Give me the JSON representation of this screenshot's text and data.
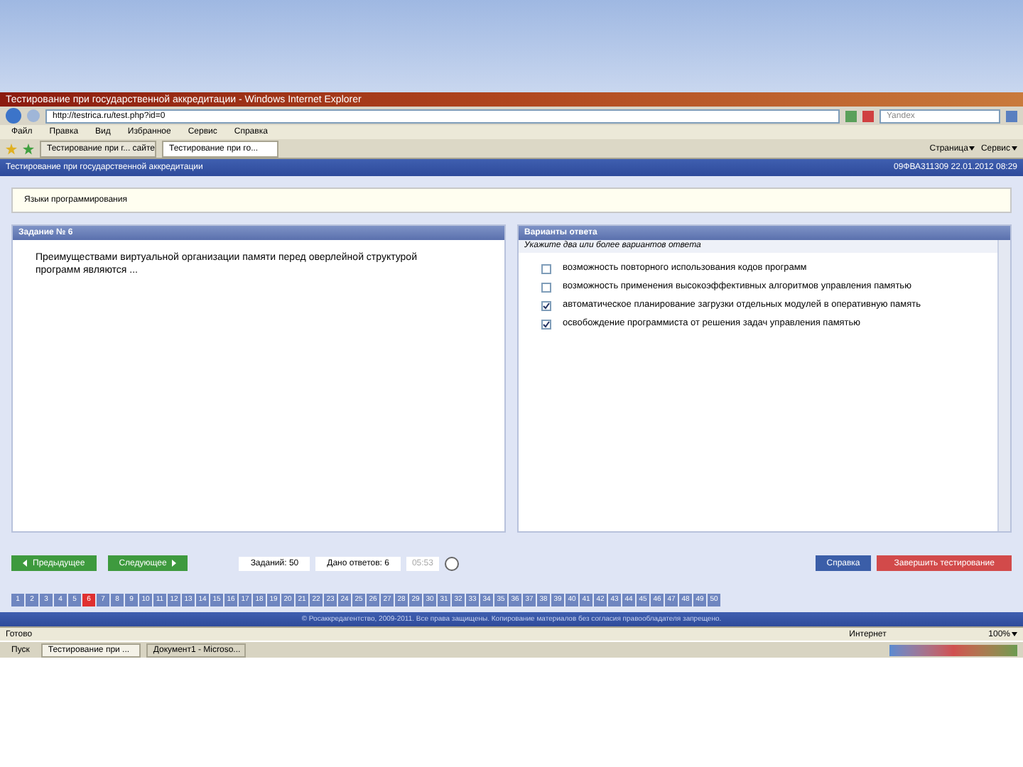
{
  "window": {
    "title": "Тестирование при государственной аккредитации - Windows Internet Explorer"
  },
  "address_bar": {
    "url": "http://testrica.ru/test.php?id=0"
  },
  "search": {
    "placeholder": "Yandex"
  },
  "menu": [
    "Файл",
    "Правка",
    "Вид",
    "Избранное",
    "Сервис",
    "Справка"
  ],
  "tabs": [
    {
      "label": "Тестирование при г... сайте",
      "selected": false
    },
    {
      "label": "Тестирование при го...",
      "selected": true
    }
  ],
  "toolbar_right": [
    "Страница",
    "Сервис"
  ],
  "page_header": {
    "title": "Тестирование при государственной аккредитации",
    "session": "09ФВА311309 22.01.2012 08:29"
  },
  "discipline": "Языки программирования",
  "task": {
    "title": "Задание № 6",
    "question": "Преимуществами виртуальной организации памяти перед оверлейной структурой программ являются ..."
  },
  "answers": {
    "title": "Варианты ответа",
    "hint": "Укажите два или более вариантов ответа",
    "options": [
      {
        "label": "возможность повторного использования кодов программ",
        "checked": false
      },
      {
        "label": "возможность применения высокоэффективных алгоритмов управления памятью",
        "checked": false
      },
      {
        "label": "автоматическое планирование загрузки отдельных модулей в оперативную память",
        "checked": true
      },
      {
        "label": "освобождение программиста от решения задач управления памятью",
        "checked": true
      }
    ]
  },
  "nav": {
    "prev": "Предыдущее",
    "next": "Следующее",
    "tasks": "Заданий: 50",
    "answered": "Дано ответов: 6",
    "timer": "05:53"
  },
  "actions": {
    "help": "Справка",
    "finish": "Завершить тестирование"
  },
  "task_numbers": [
    {
      "label": "1",
      "selected": false
    },
    {
      "label": "2",
      "selected": false
    },
    {
      "label": "3",
      "selected": false
    },
    {
      "label": "4",
      "selected": false
    },
    {
      "label": "5",
      "selected": false
    },
    {
      "label": "6",
      "selected": true
    },
    {
      "label": "7",
      "selected": false
    },
    {
      "label": "8",
      "selected": false
    },
    {
      "label": "9",
      "selected": false
    },
    {
      "label": "10",
      "selected": false
    },
    {
      "label": "11",
      "selected": false
    },
    {
      "label": "12",
      "selected": false
    },
    {
      "label": "13",
      "selected": false
    },
    {
      "label": "14",
      "selected": false
    },
    {
      "label": "15",
      "selected": false
    },
    {
      "label": "16",
      "selected": false
    },
    {
      "label": "17",
      "selected": false
    },
    {
      "label": "18",
      "selected": false
    },
    {
      "label": "19",
      "selected": false
    },
    {
      "label": "20",
      "selected": false
    },
    {
      "label": "21",
      "selected": false
    },
    {
      "label": "22",
      "selected": false
    },
    {
      "label": "23",
      "selected": false
    },
    {
      "label": "24",
      "selected": false
    },
    {
      "label": "25",
      "selected": false
    },
    {
      "label": "26",
      "selected": false
    },
    {
      "label": "27",
      "selected": false
    },
    {
      "label": "28",
      "selected": false
    },
    {
      "label": "29",
      "selected": false
    },
    {
      "label": "30",
      "selected": false
    },
    {
      "label": "31",
      "selected": false
    },
    {
      "label": "32",
      "selected": false
    },
    {
      "label": "33",
      "selected": false
    },
    {
      "label": "34",
      "selected": false
    },
    {
      "label": "35",
      "selected": false
    },
    {
      "label": "36",
      "selected": false
    },
    {
      "label": "37",
      "selected": false
    },
    {
      "label": "38",
      "selected": false
    },
    {
      "label": "39",
      "selected": false
    },
    {
      "label": "40",
      "selected": false
    },
    {
      "label": "41",
      "selected": false
    },
    {
      "label": "42",
      "selected": false
    },
    {
      "label": "43",
      "selected": false
    },
    {
      "label": "44",
      "selected": false
    },
    {
      "label": "45",
      "selected": false
    },
    {
      "label": "46",
      "selected": false
    },
    {
      "label": "47",
      "selected": false
    },
    {
      "label": "48",
      "selected": false
    },
    {
      "label": "49",
      "selected": false
    },
    {
      "label": "50",
      "selected": false
    }
  ],
  "footer": "© Росаккредагентство, 2009-2011. Все права защищены. Копирование материалов без согласия правообладателя запрещено.",
  "status_bar": {
    "text": "Готово",
    "zone": "Интернет",
    "zoom": "100%"
  },
  "taskbar": {
    "start": "Пуск",
    "items": [
      {
        "label": "Тестирование при ...",
        "selected": true
      },
      {
        "label": "Документ1 - Microso...",
        "selected": false
      }
    ]
  }
}
